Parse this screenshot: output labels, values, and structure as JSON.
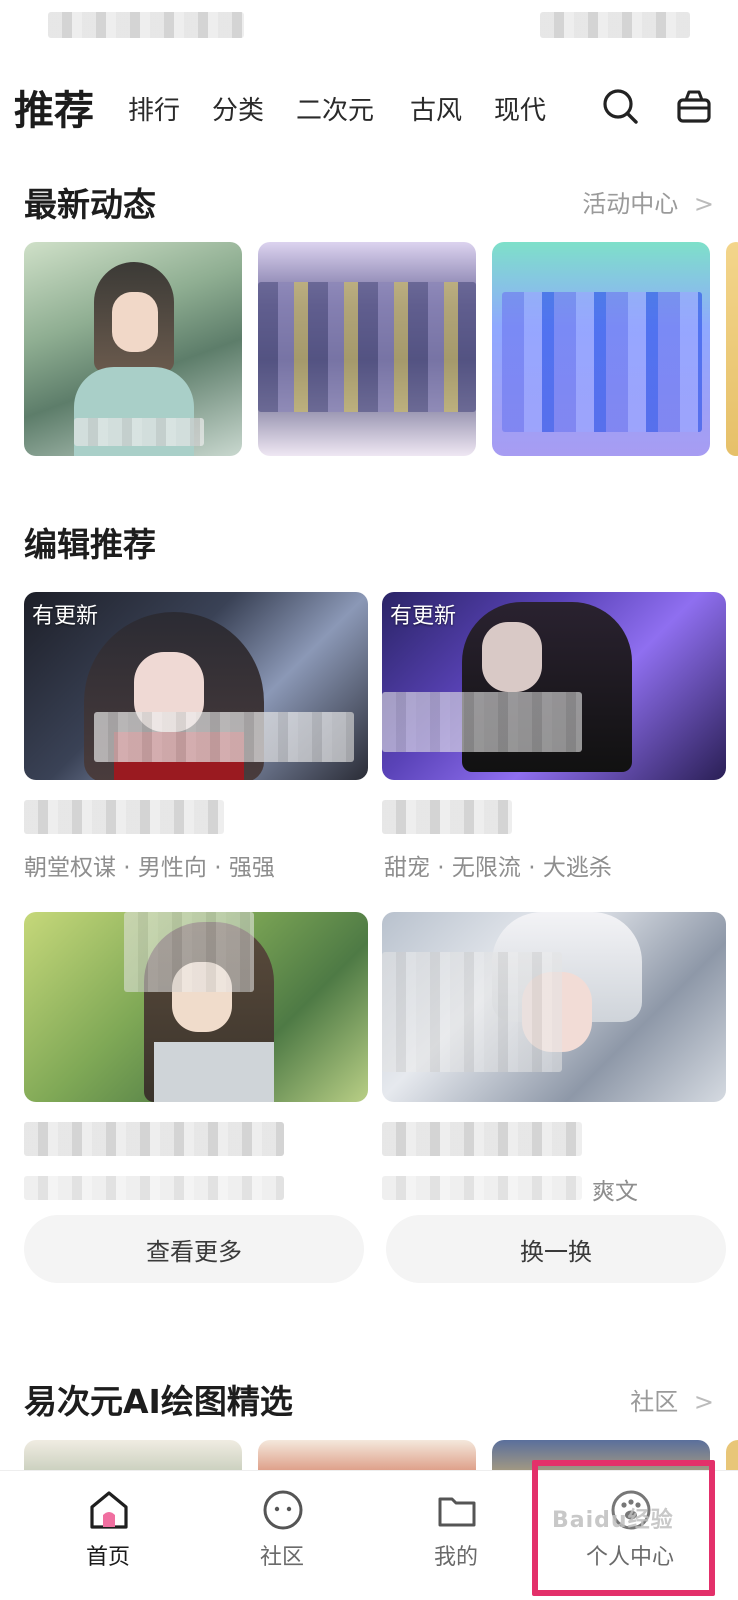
{
  "header": {
    "active_tab": "推荐",
    "tabs": [
      "排行",
      "分类",
      "二次元",
      "古风",
      "现代"
    ],
    "search_icon": "search-icon",
    "shop_icon": "gift-basket-icon"
  },
  "latest": {
    "title": "最新动态",
    "link_label": "活动中心",
    "link_chevron": ">"
  },
  "editor": {
    "title": "编辑推荐",
    "cards": [
      {
        "badge": "有更新",
        "tags": "朝堂权谋 · 男性向 · 强强"
      },
      {
        "badge": "有更新",
        "tags": "甜宠 · 无限流 · 大逃杀"
      },
      {
        "badge": "",
        "tags": ""
      },
      {
        "badge": "",
        "tags": "爽文"
      }
    ],
    "more_button": "查看更多",
    "refresh_button": "换一换"
  },
  "ai": {
    "title": "易次元AI绘图精选",
    "link_label": "社区",
    "link_chevron": ">"
  },
  "tabbar": {
    "items": [
      {
        "label": "首页",
        "icon": "home-icon"
      },
      {
        "label": "社区",
        "icon": "chat-bubble-icon"
      },
      {
        "label": "我的",
        "icon": "folder-icon"
      },
      {
        "label": "个人中心",
        "icon": "paw-icon"
      }
    ]
  },
  "watermark": "Baidu经验",
  "colors": {
    "accent": "#e3306a",
    "home_icon": "#f06fa0"
  }
}
